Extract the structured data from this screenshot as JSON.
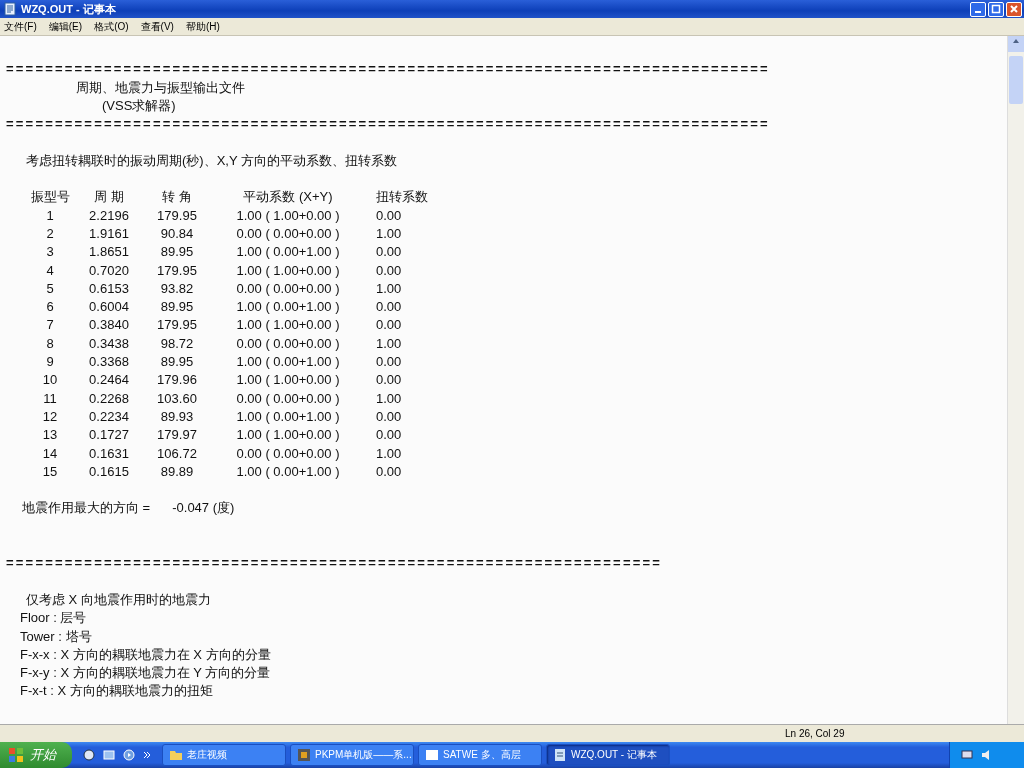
{
  "window": {
    "title": "WZQ.OUT - 记事本"
  },
  "menu": [
    "文件(F)",
    "编辑(E)",
    "格式(O)",
    "查看(V)",
    "帮助(H)"
  ],
  "document": {
    "lines": [
      {
        "kind": "blank"
      },
      {
        "kind": "rule",
        "text": "=============================================================================="
      },
      {
        "kind": "title",
        "text": "周期、地震力与振型输出文件"
      },
      {
        "kind": "subtitle",
        "text": "(VSS求解器)"
      },
      {
        "kind": "rule",
        "text": "=============================================================================="
      },
      {
        "kind": "blank"
      },
      {
        "kind": "text",
        "text": "考虑扭转耦联时的振动周期(秒)、X,Y 方向的平动系数、扭转系数"
      },
      {
        "kind": "blank"
      }
    ],
    "table": {
      "columns": [
        "振型号",
        "周 期",
        "转 角",
        "平动系数 (X+Y)",
        "扭转系数"
      ],
      "rows": [
        [
          "1",
          "2.2196",
          "179.95",
          "1.00 ( 1.00+0.00 )",
          "0.00"
        ],
        [
          "2",
          "1.9161",
          "90.84",
          "0.00 ( 0.00+0.00 )",
          "1.00"
        ],
        [
          "3",
          "1.8651",
          "89.95",
          "1.00 ( 0.00+1.00 )",
          "0.00"
        ],
        [
          "4",
          "0.7020",
          "179.95",
          "1.00 ( 1.00+0.00 )",
          "0.00"
        ],
        [
          "5",
          "0.6153",
          "93.82",
          "0.00 ( 0.00+0.00 )",
          "1.00"
        ],
        [
          "6",
          "0.6004",
          "89.95",
          "1.00 ( 0.00+1.00 )",
          "0.00"
        ],
        [
          "7",
          "0.3840",
          "179.95",
          "1.00 ( 1.00+0.00 )",
          "0.00"
        ],
        [
          "8",
          "0.3438",
          "98.72",
          "0.00 ( 0.00+0.00 )",
          "1.00"
        ],
        [
          "9",
          "0.3368",
          "89.95",
          "1.00 ( 0.00+1.00 )",
          "0.00"
        ],
        [
          "10",
          "0.2464",
          "179.96",
          "1.00 ( 1.00+0.00 )",
          "0.00"
        ],
        [
          "11",
          "0.2268",
          "103.60",
          "0.00 ( 0.00+0.00 )",
          "1.00"
        ],
        [
          "12",
          "0.2234",
          "89.93",
          "1.00 ( 0.00+1.00 )",
          "0.00"
        ],
        [
          "13",
          "0.1727",
          "179.97",
          "1.00 ( 1.00+0.00 )",
          "0.00"
        ],
        [
          "14",
          "0.1631",
          "106.72",
          "0.00 ( 0.00+0.00 )",
          "1.00"
        ],
        [
          "15",
          "0.1615",
          "89.89",
          "1.00 ( 0.00+1.00 )",
          "0.00"
        ]
      ]
    },
    "direction": {
      "label": "地震作用最大的方向 =",
      "value": "-0.047 (度)"
    },
    "after": [
      {
        "kind": "blank"
      },
      {
        "kind": "blank"
      },
      {
        "kind": "rule",
        "text": "==================================================================="
      },
      {
        "kind": "blank"
      },
      {
        "kind": "text",
        "text": "仅考虑 X 向地震作用时的地震力"
      },
      {
        "kind": "plain",
        "text": "Floor : 层号"
      },
      {
        "kind": "plain",
        "text": "Tower : 塔号"
      },
      {
        "kind": "plain",
        "text": "F-x-x : X 方向的耦联地震力在 X 方向的分量"
      },
      {
        "kind": "plain",
        "text": "F-x-y : X 方向的耦联地震力在 Y 方向的分量"
      },
      {
        "kind": "plain",
        "text": "F-x-t : X 方向的耦联地震力的扭矩"
      }
    ]
  },
  "status_bar": {
    "position": "Ln 26, Col 29"
  },
  "taskbar": {
    "start": "开始",
    "buttons": [
      {
        "label": "老庄视频",
        "kind": "folder",
        "selected": false
      },
      {
        "label": "PKPM单机版——系...",
        "kind": "app",
        "selected": false
      },
      {
        "label": "SATWE 多、高层",
        "kind": "window",
        "selected": false
      },
      {
        "label": "WZQ.OUT - 记事本",
        "kind": "notepad",
        "selected": true
      }
    ]
  }
}
